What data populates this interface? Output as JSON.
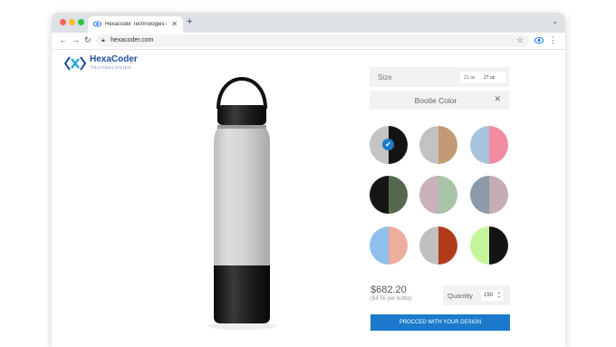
{
  "browser": {
    "tab_title": "Hexacoder Technologies (",
    "url": "hexacoder.com",
    "traffic_lights": [
      "#ff5f57",
      "#febc2e",
      "#28c840"
    ]
  },
  "brand": {
    "name": "HexaCoder",
    "tagline": "TECHNOLOGIES"
  },
  "configurator": {
    "size_label": "Size",
    "size_options": [
      "21 oz",
      "27 oz"
    ],
    "selected_size": "27 oz",
    "color_header": "Bootle Color",
    "selected_color_index": 0,
    "colors": [
      {
        "left": "#c4c4c4",
        "right": "#141414"
      },
      {
        "left": "#c2c2c2",
        "right": "#c39a72"
      },
      {
        "left": "#a8c4dc",
        "right": "#f08ca2"
      },
      {
        "left": "#151515",
        "right": "#55694e"
      },
      {
        "left": "#c9b2bb",
        "right": "#a8c4a6"
      },
      {
        "left": "#8a9aa8",
        "right": "#c4adb4"
      },
      {
        "left": "#8fbfea",
        "right": "#eeae9e"
      },
      {
        "left": "#c0c0c0",
        "right": "#b23b1b"
      },
      {
        "left": "#c4f59a",
        "right": "#141414"
      }
    ],
    "price": "$682.20",
    "per_bottle": "($4.55 per bottle)",
    "quantity_label": "Quantity",
    "quantity": "150",
    "cta": "PROCCED WITH YOUR DESIGN"
  }
}
